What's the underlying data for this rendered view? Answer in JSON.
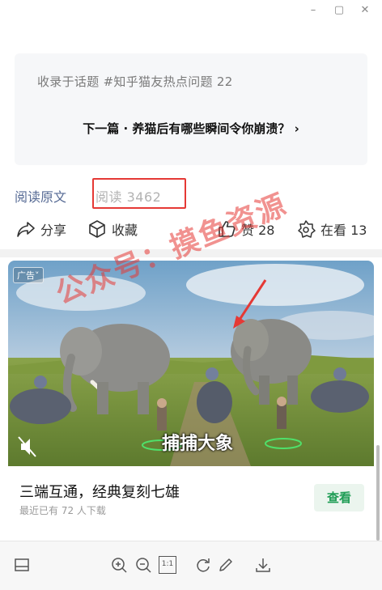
{
  "window": {
    "minimize_glyph": "–",
    "maximize_glyph": "▢",
    "close_glyph": "✕"
  },
  "card": {
    "topic_text": "收录于话题 #知乎猫友热点问题 22",
    "next_text": "下一篇 · 养猫后有哪些瞬间令你崩溃？ ›"
  },
  "read": {
    "original_link": "阅读原文",
    "count_text": "阅读 3462"
  },
  "actions": {
    "share_label": "分享",
    "collect_label": "收藏",
    "like_label": "赞 28",
    "watching_label": "在看 13"
  },
  "ad": {
    "tag": "广告˅",
    "caption": "捕捕大象",
    "title": "三端互通，经典复刻七雄",
    "subtitle": "最近已有 72 人下载",
    "button": "查看"
  },
  "watermark": "公众号：摸鱼资源",
  "toolbar": {
    "page_fit_label": "1:1"
  },
  "colors": {
    "link": "#576b95",
    "annotation_red": "#e53935",
    "ad_button_green": "#1f9d55"
  }
}
